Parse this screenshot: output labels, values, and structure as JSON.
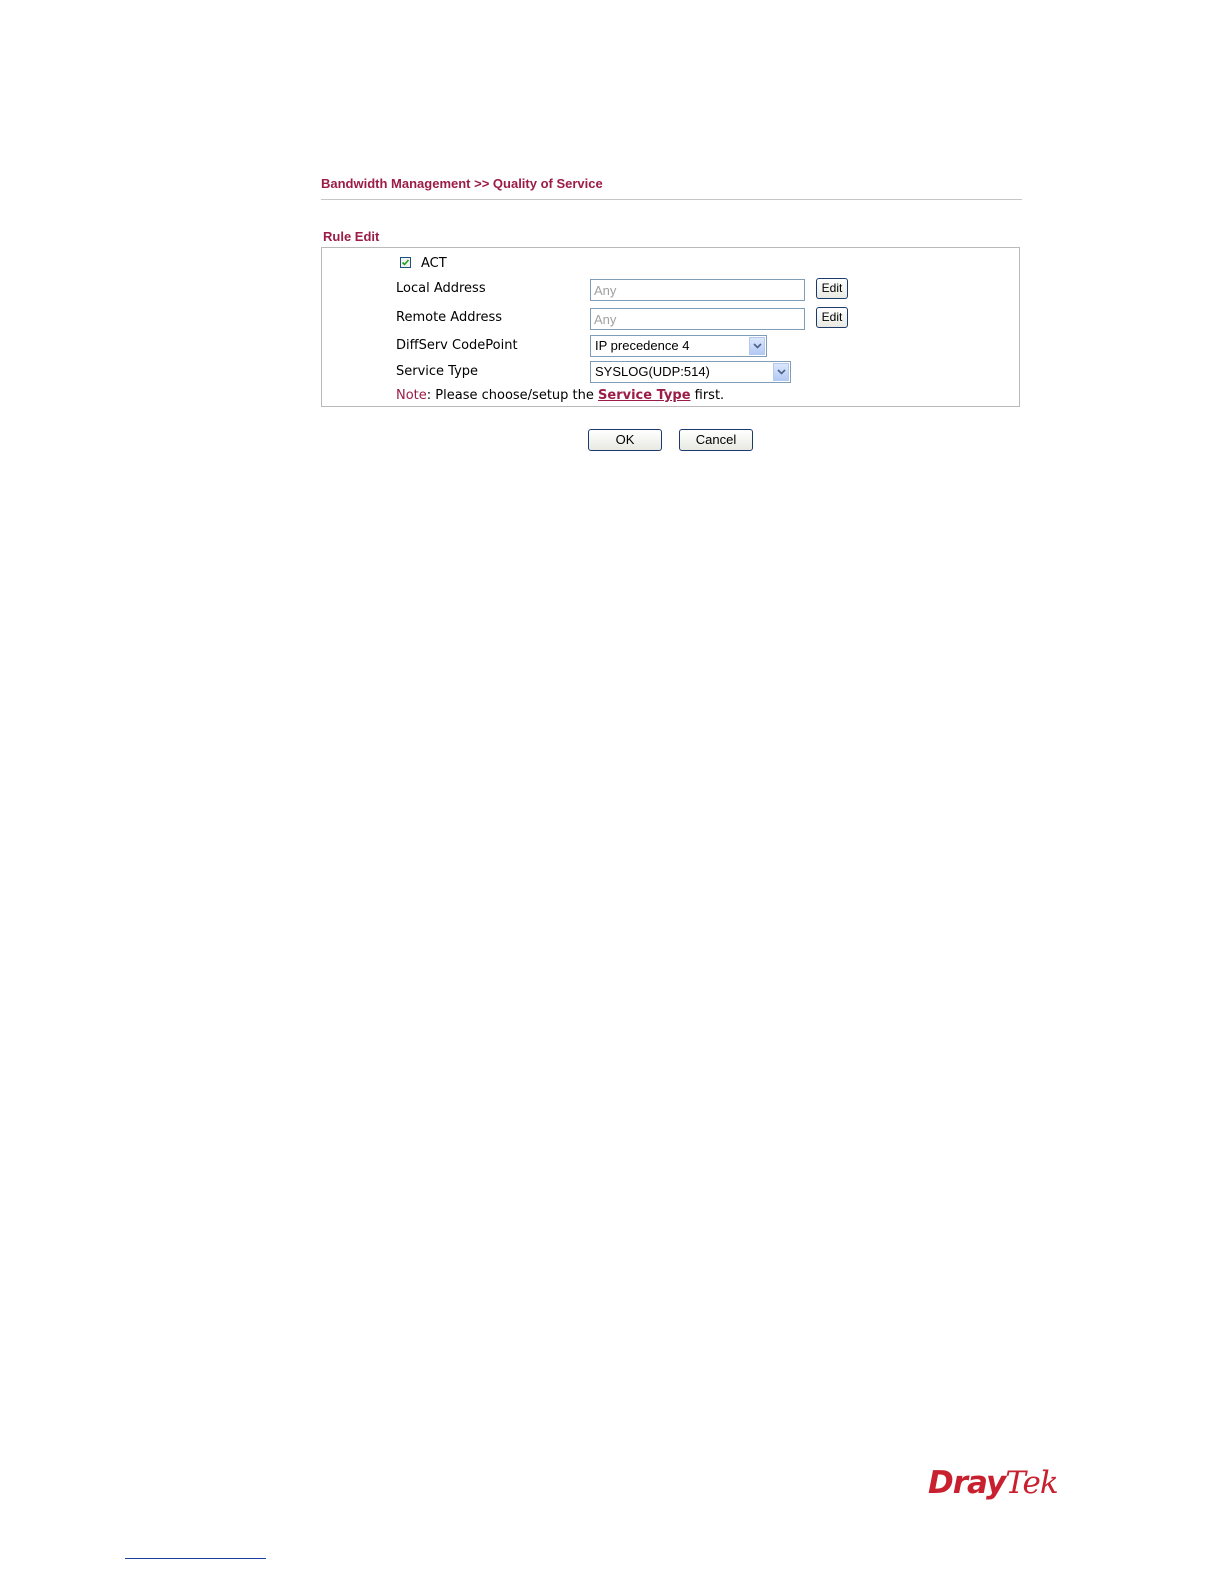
{
  "breadcrumb": "Bandwidth Management >> Quality of Service",
  "section_title": "Rule Edit",
  "act": {
    "label": "ACT",
    "checked": true
  },
  "fields": {
    "local_address": {
      "label": "Local Address",
      "value": "Any",
      "button": "Edit"
    },
    "remote_address": {
      "label": "Remote Address",
      "value": "Any",
      "button": "Edit"
    },
    "diffserv": {
      "label": "DiffServ CodePoint",
      "selected": "IP precedence 4"
    },
    "service_type": {
      "label": "Service Type",
      "selected": "SYSLOG(UDP:514)"
    }
  },
  "note": {
    "prefix": "Note",
    "text_before": ": Please choose/setup the ",
    "link": "Service Type",
    "text_after": " first."
  },
  "actions": {
    "ok": "OK",
    "cancel": "Cancel"
  },
  "logo": {
    "part1": "Dray",
    "part2": "Tek"
  },
  "colors": {
    "accent": "#9b1c46",
    "logo": "#c8202f"
  }
}
